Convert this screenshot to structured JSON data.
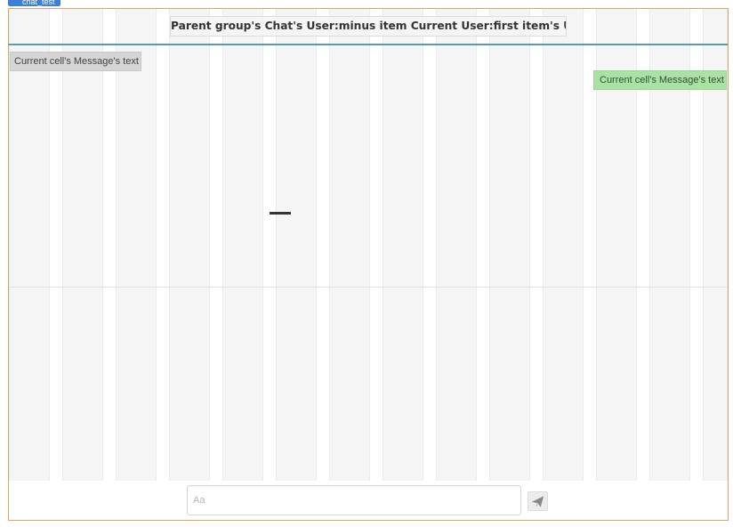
{
  "element_tag": {
    "label": "chat_test"
  },
  "header": {
    "title": "Parent group's Chat's User:minus item Current User:first item's Username"
  },
  "messages": [
    {
      "text": "Current cell's Message's text",
      "side": "left",
      "color": "#d5d5d5"
    },
    {
      "text": "Current cell's Message's text",
      "side": "right",
      "color": "#a9e3a4"
    }
  ],
  "footer": {
    "input": {
      "value": "",
      "placeholder": "Aa"
    },
    "send_button": {
      "icon": "paper-plane-icon"
    }
  },
  "colors": {
    "frame_border": "#d8a46a",
    "header_divider": "#5c9aa8",
    "element_tag": "#3c7fd9",
    "grid_column": "#f5f5f5"
  }
}
